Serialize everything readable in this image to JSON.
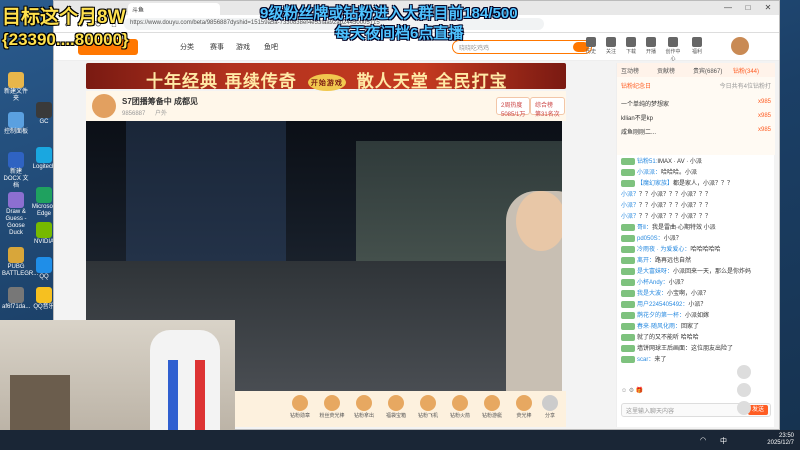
{
  "overlay": {
    "goal": "目标这个月8W",
    "range": "{23390....80000}",
    "fans_line": "9级粉丝牌或钻粉进入大群目前184/500",
    "live_line": "每天夜间档6点直播"
  },
  "browser": {
    "tab_title": "斗鱼",
    "url": "https://www.douyu.com/beta/9856887dyshid=15159a5a-7330838ef4e53faa92ab24450005715",
    "win_min": "—",
    "win_max": "□",
    "win_close": "✕"
  },
  "site": {
    "nav": [
      "分类",
      "赛事",
      "游戏",
      "鱼吧"
    ],
    "search_placeholder": "晓晓吃鸡鸡",
    "header_icons": [
      "历史",
      "关注",
      "下载",
      "开播",
      "创作中心",
      "福利"
    ]
  },
  "banner": {
    "left_text": "十年经典 再续传奇",
    "badge": "开始游戏",
    "right_text": "散人天堂 全民打宝"
  },
  "room": {
    "title": "S7团播筹备中 成都见",
    "id": "9856887",
    "category": "户外",
    "chip1_title": "2周热度",
    "chip1_value": "5085/1万",
    "chip2_title": "综合榜",
    "chip2_value": "第31名次"
  },
  "gifts": [
    "钻粉勋章",
    "粉丝荧光棒",
    "钻粉拿出",
    "福袋宝箱",
    "钻粉飞机",
    "钻粉火箭",
    "钻粉游艇",
    "荧光棒",
    "分享",
    "更多"
  ],
  "chat": {
    "tabs": [
      {
        "label": "互动榜",
        "active": false
      },
      {
        "label": "贡献榜",
        "active": false
      },
      {
        "label": "贵宾(6867)",
        "active": false
      },
      {
        "label": "钻粉(344)",
        "active": true
      }
    ],
    "rank_header": "钻粉纪念日",
    "rank_sub": "今日共有4位钻粉打",
    "rank_rows": [
      {
        "name": "一个单纯的梦想家",
        "val": "x985"
      },
      {
        "name": "kllian不是kp",
        "val": "x985"
      },
      {
        "name": "咸鱼刚刚二...",
        "val": "x985"
      }
    ],
    "messages": [
      {
        "user": "钻粉51:",
        "text": "IMAX · AV · 小派"
      },
      {
        "user": "小派派：",
        "text": "哈哈哈。小派"
      },
      {
        "user": "【魔幻家族】",
        "text": "都是家人，小派？？？"
      },
      {
        "user": "小派？",
        "text": "？？小派？？？小派？？？"
      },
      {
        "user": "小派？",
        "text": "？？小派？？？小派？？？"
      },
      {
        "user": "小派？",
        "text": "？？小派？？？小派？？？"
      },
      {
        "user": "哥Ⅱ：",
        "text": "我是雷曲·心期特效 小派"
      },
      {
        "user": "pd050S：",
        "text": "小派？"
      },
      {
        "user": "冷雨夜 · 为爱爱心：",
        "text": "哈哈哈哈哈"
      },
      {
        "user": "离开：",
        "text": "路再远也自然"
      },
      {
        "user": "是大富妹呀：",
        "text": "小派回来一天，那么是你炸妈"
      },
      {
        "user": "小杯Andy：",
        "text": "小派？"
      },
      {
        "user": "我是大波：",
        "text": "小宝啊，小派？"
      },
      {
        "user": "用户2245405492：",
        "text": "小派？"
      },
      {
        "user": "鹊花夕的第一杯：",
        "text": "小派如嫁"
      },
      {
        "user": "春来·随风化雨：",
        "text": "回家了"
      },
      {
        "user": "",
        "text": "就了的又不能听 哈哈哈"
      },
      {
        "user": "",
        "text": "墙饼网球王后画面：这位朋友出险了"
      },
      {
        "user": "scar：",
        "text": "来了"
      }
    ],
    "tools": "☺ ⚙ 🎁",
    "input_placeholder": "这里输入聊天内容",
    "send_label": "发送"
  },
  "desktop_icons": [
    {
      "label": "新建文件夹",
      "color": "#e8b64b"
    },
    {
      "label": "控制面板",
      "color": "#5aa0e0"
    },
    {
      "label": "新建 DOCX 文档",
      "color": "#2f63c2"
    },
    {
      "label": "Draw & Guess - Goose Duck",
      "color": "#8c6fd0"
    },
    {
      "label": "PUBG BATTLEGR...",
      "color": "#d8a63a"
    },
    {
      "label": "af6f71da...",
      "color": "#777"
    },
    {
      "label": "GC",
      "color": "#3a3a3a"
    },
    {
      "label": "Logitech",
      "color": "#1aa7e0"
    },
    {
      "label": "Microsoft Edge",
      "color": "#1fa15f"
    },
    {
      "label": "NVIDIA",
      "color": "#76b900"
    },
    {
      "label": "QQ",
      "color": "#1f8ee8"
    },
    {
      "label": "QQ音乐",
      "color": "#f6c020"
    }
  ],
  "taskbar": {
    "time": "23:50",
    "date": "2025/12/7",
    "lang": "中"
  },
  "colors": {
    "douyu_orange": "#ff7700",
    "overlay_yellow": "#ffe14d",
    "overlay_blue": "#4ec3ff",
    "banner_red": "#b2321e"
  }
}
